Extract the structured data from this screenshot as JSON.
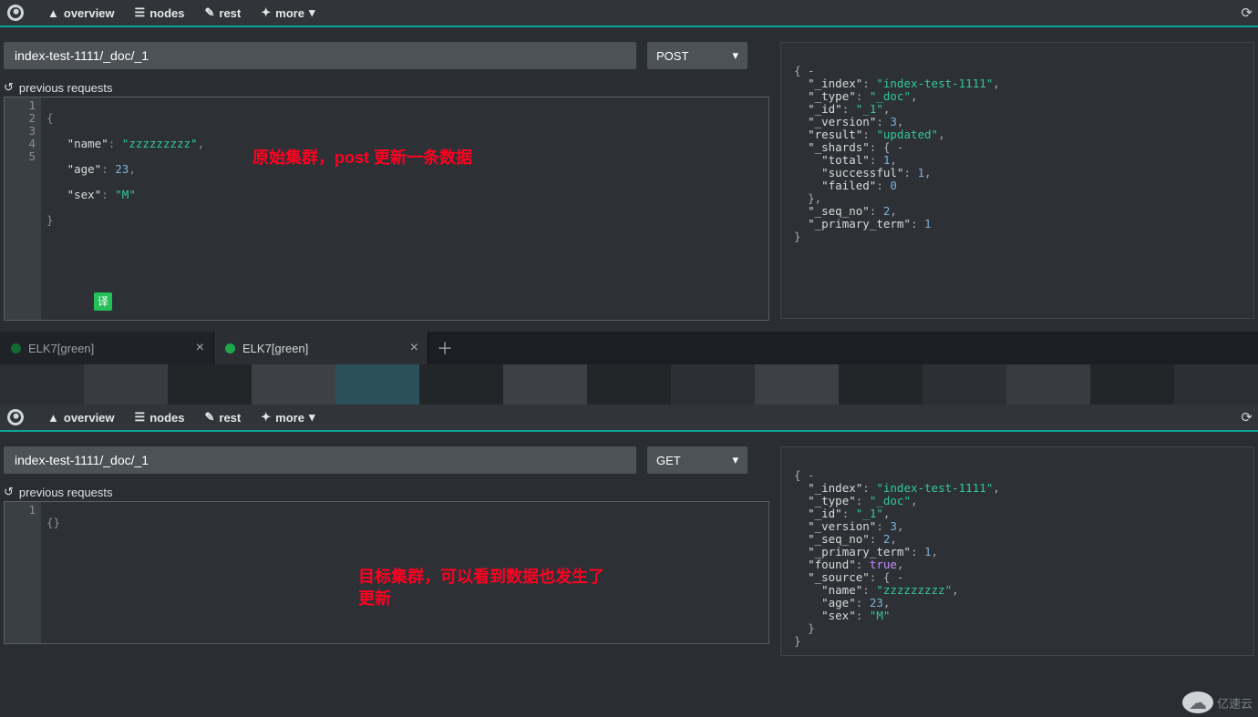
{
  "nav": {
    "overview": "overview",
    "nodes": "nodes",
    "rest": "rest",
    "more": "more"
  },
  "top": {
    "path": "index-test-1111/_doc/_1",
    "method": "POST",
    "prev_requests": "previous requests",
    "editor": {
      "lines": [
        "1",
        "2",
        "3",
        "4",
        "5"
      ],
      "l1_a": "{",
      "l2_k": "\"name\"",
      "l2_colon": ": ",
      "l2_v": "\"zzzzzzzzz\"",
      "l2_end": ",",
      "l3_k": "\"age\"",
      "l3_colon": ": ",
      "l3_v": "23",
      "l3_end": ",",
      "l4_k": "\"sex\"",
      "l4_colon": ": ",
      "l4_v": "\"M\"",
      "l5_a": "}"
    },
    "annotation": "原始集群，post 更新一条数据",
    "translate_badge": "译",
    "response_lines": {
      "l0": "{ -",
      "l1_k": "\"_index\"",
      "l1_v": "\"index-test-1111\"",
      "l2_k": "\"_type\"",
      "l2_v": "\"_doc\"",
      "l3_k": "\"_id\"",
      "l3_v": "\"_1\"",
      "l4_k": "\"_version\"",
      "l4_v": "3",
      "l5_k": "\"result\"",
      "l5_v": "\"updated\"",
      "l6_k": "\"_shards\"",
      "l6_v": "{ -",
      "l7_k": "\"total\"",
      "l7_v": "1",
      "l8_k": "\"successful\"",
      "l8_v": "1",
      "l9_k": "\"failed\"",
      "l9_v": "0",
      "l10": "},",
      "l11_k": "\"_seq_no\"",
      "l11_v": "2",
      "l12_k": "\"_primary_term\"",
      "l12_v": "1",
      "l13": "}"
    }
  },
  "tabs": [
    {
      "label": "ELK7[green]"
    },
    {
      "label": "ELK7[green]"
    }
  ],
  "bottom": {
    "path": "index-test-1111/_doc/_1",
    "method": "GET",
    "prev_requests": "previous requests",
    "editor_lines": [
      "1"
    ],
    "editor_content": "{}",
    "annotation": "目标集群，可以看到数据也发生了\n更新",
    "response_lines": {
      "l0": "{ -",
      "l1_k": "\"_index\"",
      "l1_v": "\"index-test-1111\"",
      "l2_k": "\"_type\"",
      "l2_v": "\"_doc\"",
      "l3_k": "\"_id\"",
      "l3_v": "\"_1\"",
      "l4_k": "\"_version\"",
      "l4_v": "3",
      "l5_k": "\"_seq_no\"",
      "l5_v": "2",
      "l6_k": "\"_primary_term\"",
      "l6_v": "1",
      "l7_k": "\"found\"",
      "l7_v": "true",
      "l8_k": "\"_source\"",
      "l8_v": "{ -",
      "l9_k": "\"name\"",
      "l9_v": "\"zzzzzzzzz\"",
      "l10_k": "\"age\"",
      "l10_v": "23",
      "l11_k": "\"sex\"",
      "l11_v": "\"M\"",
      "l12": "}",
      "l13": "}"
    }
  },
  "watermark": "亿速云"
}
